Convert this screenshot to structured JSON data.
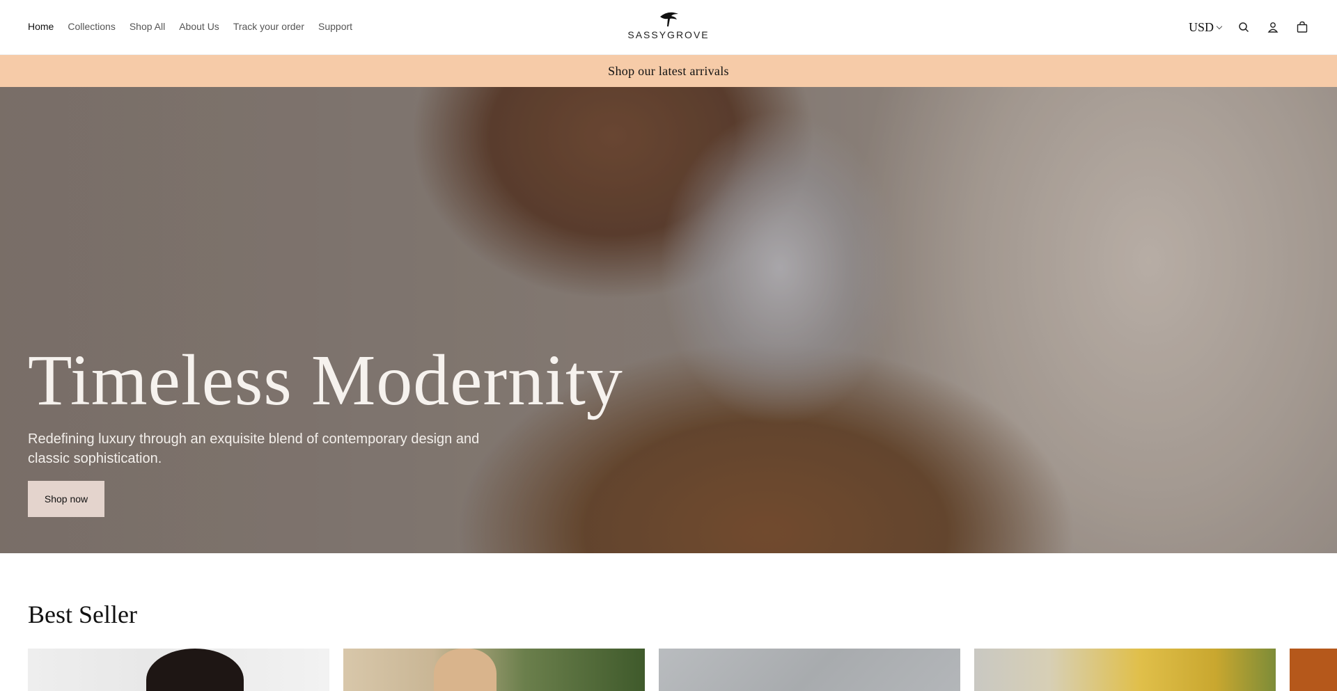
{
  "nav": {
    "items": [
      "Home",
      "Collections",
      "Shop All",
      "About Us",
      "Track your order",
      "Support"
    ]
  },
  "brand": {
    "name": "SASSYGROVE"
  },
  "header": {
    "currency": "USD",
    "search_icon": "search-icon",
    "account_icon": "account-icon",
    "cart_icon": "cart-icon"
  },
  "announcement": {
    "text": "Shop our latest arrivals"
  },
  "hero": {
    "title": "Timeless Modernity",
    "subtitle": "Redefining luxury through an exquisite blend of contemporary design and classic sophistication.",
    "button_label": "Shop now"
  },
  "bestseller": {
    "heading": "Best Seller"
  },
  "colors": {
    "announcement_bg": "#f6cba8",
    "hero_button_bg": "#e4d4cd"
  }
}
